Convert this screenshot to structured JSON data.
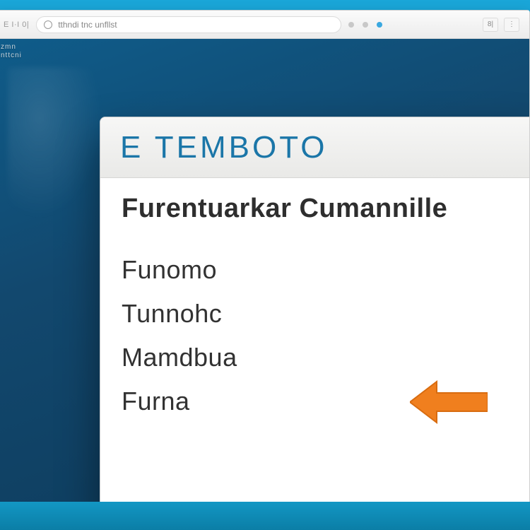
{
  "addressbar": {
    "left_label": "E I·I 0|",
    "url_text": "tthndi tnc unfllst",
    "right_chip1": "8|",
    "right_chip2": "⋮"
  },
  "viewport": {
    "corner_label_line1": "zmn",
    "corner_label_line2": "nttcni"
  },
  "popup": {
    "title": "E TEMBOTO",
    "subtitle": "Furentuarkar Cumannille",
    "items": [
      "Funomo",
      "Tunnohc",
      "Mamdbua",
      "Furna"
    ]
  }
}
